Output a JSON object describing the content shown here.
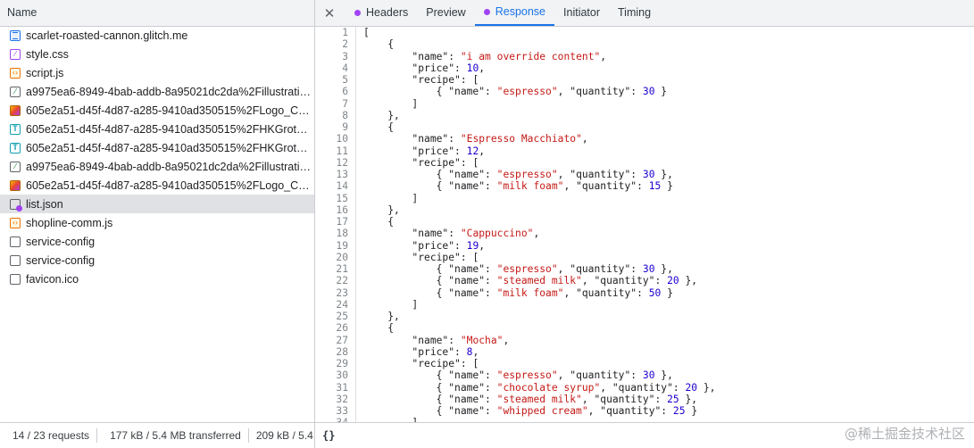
{
  "name_header": "Name",
  "requests": [
    {
      "name": "scarlet-roasted-cannon.glitch.me",
      "icon": "document-icon",
      "cls": "ic-doc"
    },
    {
      "name": "style.css",
      "icon": "stylesheet-icon",
      "cls": "ic-css",
      "glyph": "⁄"
    },
    {
      "name": "script.js",
      "icon": "script-icon",
      "cls": "ic-js",
      "glyph": "‹›"
    },
    {
      "name": "a9975ea6-8949-4bab-addb-8a95021dc2da%2Fillustratio...",
      "icon": "image-icon",
      "cls": "ic-img",
      "glyph": "⁄"
    },
    {
      "name": "605e2a51-d45f-4d87-a285-9410ad350515%2FLogo_Col...",
      "icon": "image-icon",
      "cls": "ic-imgc"
    },
    {
      "name": "605e2a51-d45f-4d87-a285-9410ad350515%2FHKGrotes...",
      "icon": "font-icon",
      "cls": "ic-font",
      "glyph": "T"
    },
    {
      "name": "605e2a51-d45f-4d87-a285-9410ad350515%2FHKGrotes...",
      "icon": "font-icon",
      "cls": "ic-font",
      "glyph": "T"
    },
    {
      "name": "a9975ea6-8949-4bab-addb-8a95021dc2da%2Fillustratio...",
      "icon": "image-icon",
      "cls": "ic-img",
      "glyph": "⁄"
    },
    {
      "name": "605e2a51-d45f-4d87-a285-9410ad350515%2FLogo_Col...",
      "icon": "image-icon",
      "cls": "ic-imgc"
    },
    {
      "name": "list.json",
      "icon": "json-override-icon",
      "cls": "ic-json",
      "selected": true
    },
    {
      "name": "shopline-comm.js",
      "icon": "script-icon",
      "cls": "ic-js",
      "glyph": "‹›"
    },
    {
      "name": "service-config",
      "icon": "blank-file-icon",
      "cls": "ic-blank"
    },
    {
      "name": "service-config",
      "icon": "blank-file-icon",
      "cls": "ic-blank"
    },
    {
      "name": "favicon.ico",
      "icon": "blank-file-icon",
      "cls": "ic-blank"
    }
  ],
  "status": {
    "requests": "14 / 23 requests",
    "transferred": "177 kB / 5.4 MB transferred",
    "resources": "209 kB / 5.4"
  },
  "tabs": {
    "close_glyph": "✕",
    "items": [
      {
        "label": "Headers",
        "dot": true,
        "active": false
      },
      {
        "label": "Preview",
        "dot": false,
        "active": false
      },
      {
        "label": "Response",
        "dot": true,
        "active": true
      },
      {
        "label": "Initiator",
        "dot": false,
        "active": false
      },
      {
        "label": "Timing",
        "dot": false,
        "active": false
      }
    ]
  },
  "response_lines": [
    "[",
    "    {",
    "        \"name\": \"i am override content\",",
    "        \"price\": 10,",
    "        \"recipe\": [",
    "            { \"name\": \"espresso\", \"quantity\": 30 }",
    "        ]",
    "    },",
    "    {",
    "        \"name\": \"Espresso Macchiato\",",
    "        \"price\": 12,",
    "        \"recipe\": [",
    "            { \"name\": \"espresso\", \"quantity\": 30 },",
    "            { \"name\": \"milk foam\", \"quantity\": 15 }",
    "        ]",
    "    },",
    "    {",
    "        \"name\": \"Cappuccino\",",
    "        \"price\": 19,",
    "        \"recipe\": [",
    "            { \"name\": \"espresso\", \"quantity\": 30 },",
    "            { \"name\": \"steamed milk\", \"quantity\": 20 },",
    "            { \"name\": \"milk foam\", \"quantity\": 50 }",
    "        ]",
    "    },",
    "    {",
    "        \"name\": \"Mocha\",",
    "        \"price\": 8,",
    "        \"recipe\": [",
    "            { \"name\": \"espresso\", \"quantity\": 30 },",
    "            { \"name\": \"chocolate syrup\", \"quantity\": 20 },",
    "            { \"name\": \"steamed milk\", \"quantity\": 25 },",
    "            { \"name\": \"whipped cream\", \"quantity\": 25 }",
    "        ]"
  ],
  "footer": {
    "format_label": "{}",
    "watermark": "@稀土掘金技术社区"
  }
}
